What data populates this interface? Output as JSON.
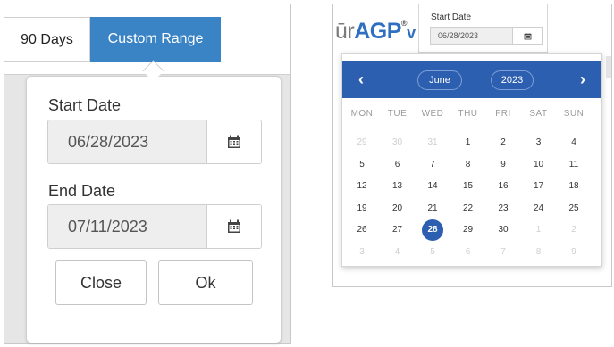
{
  "left": {
    "range_90_days": "90 Days",
    "range_custom": "Custom Range",
    "start_label": "Start Date",
    "start_value": "06/28/2023",
    "end_label": "End Date",
    "end_value": "07/11/2023",
    "close_label": "Close",
    "ok_label": "Ok",
    "accent": "#3a84c6"
  },
  "right": {
    "logo_prefix": "ūr",
    "logo_brand": "AGP",
    "logo_suffix": "®",
    "logo_fragment": "v",
    "start_label": "Start Date",
    "start_value": "06/28/2023",
    "calendar": {
      "month": "June",
      "year": "2023",
      "prev": "‹",
      "next": "›",
      "weekdays": [
        "MON",
        "TUE",
        "WED",
        "THU",
        "FRI",
        "SAT",
        "SUN"
      ],
      "weeks": [
        [
          {
            "d": "29",
            "m": true
          },
          {
            "d": "30",
            "m": true
          },
          {
            "d": "31",
            "m": true
          },
          {
            "d": "1"
          },
          {
            "d": "2"
          },
          {
            "d": "3"
          },
          {
            "d": "4"
          }
        ],
        [
          {
            "d": "5"
          },
          {
            "d": "6"
          },
          {
            "d": "7"
          },
          {
            "d": "8"
          },
          {
            "d": "9"
          },
          {
            "d": "10"
          },
          {
            "d": "11"
          }
        ],
        [
          {
            "d": "12"
          },
          {
            "d": "13"
          },
          {
            "d": "14"
          },
          {
            "d": "15"
          },
          {
            "d": "16"
          },
          {
            "d": "17"
          },
          {
            "d": "18"
          }
        ],
        [
          {
            "d": "19"
          },
          {
            "d": "20"
          },
          {
            "d": "21"
          },
          {
            "d": "22"
          },
          {
            "d": "23"
          },
          {
            "d": "24"
          },
          {
            "d": "25"
          }
        ],
        [
          {
            "d": "26"
          },
          {
            "d": "27"
          },
          {
            "d": "28",
            "sel": true
          },
          {
            "d": "29"
          },
          {
            "d": "30"
          },
          {
            "d": "1",
            "m": true
          },
          {
            "d": "2",
            "m": true
          }
        ],
        [
          {
            "d": "3",
            "m": true
          },
          {
            "d": "4",
            "m": true
          },
          {
            "d": "5",
            "m": true
          },
          {
            "d": "6",
            "m": true
          },
          {
            "d": "7",
            "m": true
          },
          {
            "d": "8",
            "m": true
          },
          {
            "d": "9",
            "m": true
          }
        ]
      ],
      "header_color": "#2d5fb0"
    }
  }
}
